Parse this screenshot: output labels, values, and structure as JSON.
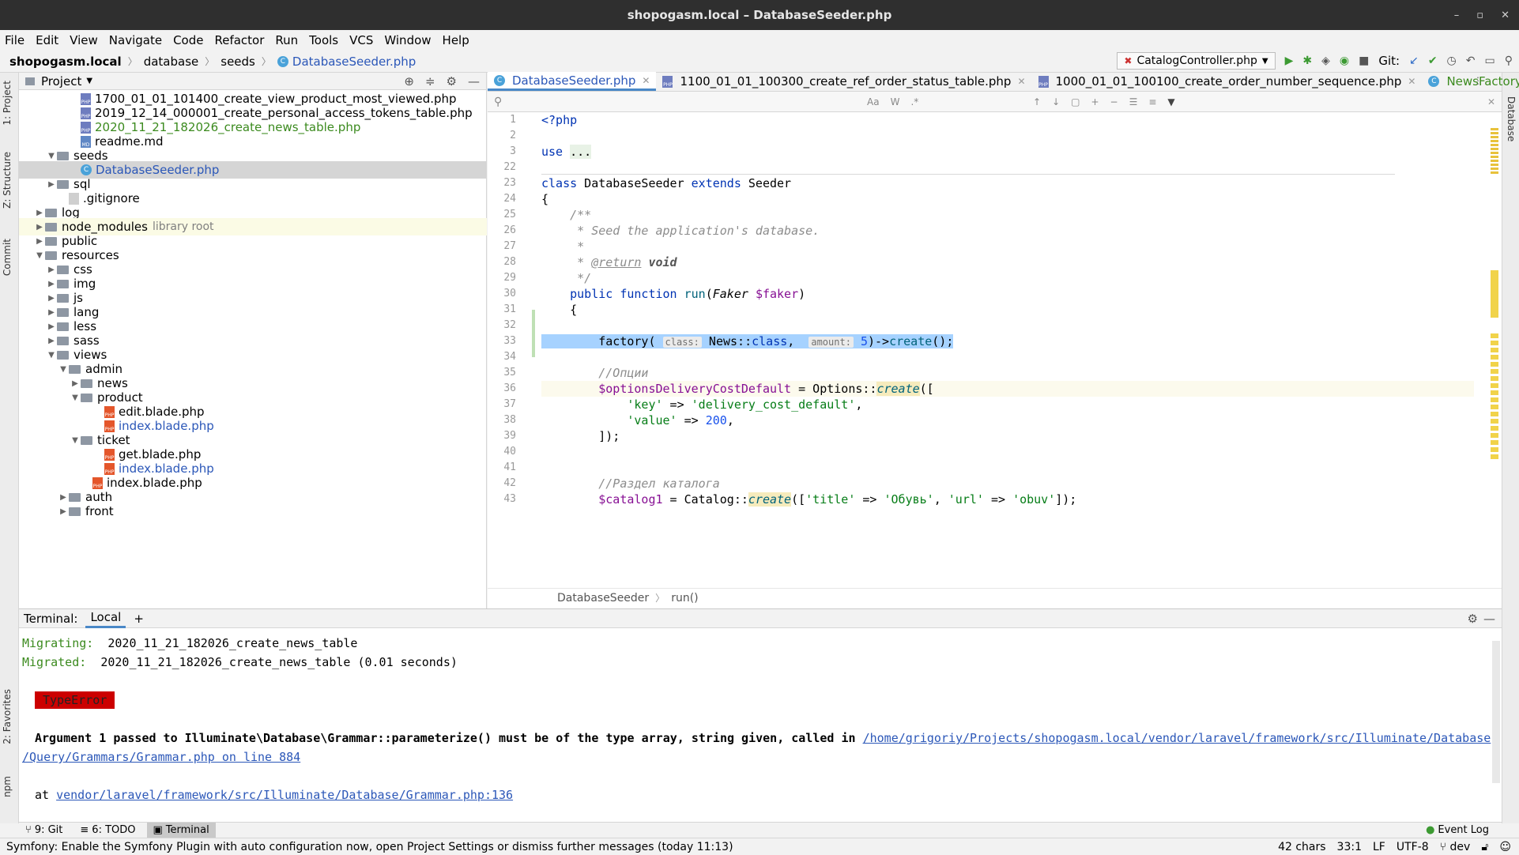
{
  "window": {
    "title": "shopogasm.local – DatabaseSeeder.php",
    "controls": [
      "–",
      "▫",
      "✕"
    ]
  },
  "menu": [
    "File",
    "Edit",
    "View",
    "Navigate",
    "Code",
    "Refactor",
    "Run",
    "Tools",
    "VCS",
    "Window",
    "Help"
  ],
  "nav": {
    "crumbs": [
      "shopogasm.local",
      "database",
      "seeds",
      "DatabaseSeeder.php"
    ],
    "run_config": "CatalogController.php",
    "git_label": "Git:"
  },
  "left_tabs": [
    "1: Project",
    "Z: Structure",
    "Commit",
    "2: Favorites",
    "npm"
  ],
  "right_tabs": [
    "Database"
  ],
  "project": {
    "title": "Project",
    "rows": [
      {
        "indent": 4,
        "kind": "php",
        "label": "1700_01_01_101400_create_view_product_most_viewed.php"
      },
      {
        "indent": 4,
        "kind": "php",
        "label": "2019_12_14_000001_create_personal_access_tokens_table.php"
      },
      {
        "indent": 4,
        "kind": "php",
        "label": "2020_11_21_182026_create_news_table.php",
        "style": "green"
      },
      {
        "indent": 4,
        "kind": "md",
        "label": "readme.md"
      },
      {
        "indent": 2,
        "kind": "folder",
        "arrow": "▼",
        "label": "seeds"
      },
      {
        "indent": 4,
        "kind": "class",
        "label": "DatabaseSeeder.php",
        "style": "blue",
        "selected": true
      },
      {
        "indent": 2,
        "kind": "folder",
        "arrow": "▶",
        "label": "sql"
      },
      {
        "indent": 3,
        "kind": "git",
        "label": ".gitignore"
      },
      {
        "indent": 1,
        "kind": "folder",
        "arrow": "▶",
        "label": "log"
      },
      {
        "indent": 1,
        "kind": "folder",
        "arrow": "▶",
        "label": "node_modules",
        "extra": "library root",
        "lib": true
      },
      {
        "indent": 1,
        "kind": "folder",
        "arrow": "▶",
        "label": "public"
      },
      {
        "indent": 1,
        "kind": "folder",
        "arrow": "▼",
        "label": "resources"
      },
      {
        "indent": 2,
        "kind": "folder",
        "arrow": "▶",
        "label": "css"
      },
      {
        "indent": 2,
        "kind": "folder",
        "arrow": "▶",
        "label": "img"
      },
      {
        "indent": 2,
        "kind": "folder",
        "arrow": "▶",
        "label": "js"
      },
      {
        "indent": 2,
        "kind": "folder",
        "arrow": "▶",
        "label": "lang"
      },
      {
        "indent": 2,
        "kind": "folder",
        "arrow": "▶",
        "label": "less"
      },
      {
        "indent": 2,
        "kind": "folder",
        "arrow": "▶",
        "label": "sass"
      },
      {
        "indent": 2,
        "kind": "folder",
        "arrow": "▼",
        "label": "views"
      },
      {
        "indent": 3,
        "kind": "folder",
        "arrow": "▼",
        "label": "admin"
      },
      {
        "indent": 4,
        "kind": "folder",
        "arrow": "▶",
        "label": "news"
      },
      {
        "indent": 4,
        "kind": "folder",
        "arrow": "▼",
        "label": "product"
      },
      {
        "indent": 6,
        "kind": "blade",
        "label": "edit.blade.php"
      },
      {
        "indent": 6,
        "kind": "blade",
        "label": "index.blade.php",
        "style": "blue"
      },
      {
        "indent": 4,
        "kind": "folder",
        "arrow": "▼",
        "label": "ticket"
      },
      {
        "indent": 6,
        "kind": "blade",
        "label": "get.blade.php"
      },
      {
        "indent": 6,
        "kind": "blade",
        "label": "index.blade.php",
        "style": "blue"
      },
      {
        "indent": 5,
        "kind": "blade",
        "label": "index.blade.php"
      },
      {
        "indent": 3,
        "kind": "folder",
        "arrow": "▶",
        "label": "auth"
      },
      {
        "indent": 3,
        "kind": "folder",
        "arrow": "▶",
        "label": "front"
      }
    ]
  },
  "tabs": [
    {
      "label": "DatabaseSeeder.php",
      "active": true,
      "icon": "class"
    },
    {
      "label": "1100_01_01_100300_create_ref_order_status_table.php",
      "icon": "php"
    },
    {
      "label": "1000_01_01_100100_create_order_number_sequence.php",
      "icon": "php"
    },
    {
      "label": "NewsFactory.php",
      "icon": "class",
      "style": "green"
    }
  ],
  "search": {
    "placeholder": "",
    "opts": [
      "Aa",
      "W",
      ".*"
    ]
  },
  "code": {
    "line_numbers": [
      "1",
      "2",
      "3",
      "22",
      "23",
      "24",
      "25",
      "26",
      "27",
      "28",
      "29",
      "30",
      "31",
      "32",
      "33",
      "34",
      "35",
      "36",
      "37",
      "38",
      "39",
      "40",
      "41",
      "42",
      "43"
    ]
  },
  "editor_breadcrumb": [
    "DatabaseSeeder",
    "run()"
  ],
  "terminal": {
    "label": "Terminal:",
    "tab": "Local",
    "add": "+",
    "lines": {
      "migrating_label": "Migrating:",
      "migrating_value": "2020_11_21_182026_create_news_table",
      "migrated_label": "Migrated:",
      "migrated_value": "2020_11_21_182026_create_news_table (0.01 seconds)",
      "error": "TypeError",
      "arg_text": "Argument 1 passed to Illuminate\\Database\\Grammar::parameterize() must be of the type array, string given, called in ",
      "arg_link1": "/home/grigoriy/Projects/shopogasm.local/vendor/laravel/framework/src/Illuminate/Database",
      "arg_link2": "/Query/Grammars/Grammar.php on line 884",
      "at_label": "at ",
      "at_link": "vendor/laravel/framework/src/Illuminate/Database/Grammar.php:136"
    }
  },
  "bottom_tools": [
    {
      "icon": "⑂",
      "label": "9: Git"
    },
    {
      "icon": "≡",
      "label": "6: TODO"
    },
    {
      "icon": "▣",
      "label": "Terminal",
      "active": true
    }
  ],
  "event_log": "Event Log",
  "status": {
    "message": "Symfony: Enable the Symfony Plugin with auto configuration now, open Project Settings or dismiss further messages (today 11:13)",
    "chars": "42 chars",
    "pos": "33:1",
    "eol": "LF",
    "enc": "UTF-8",
    "branch": "dev"
  },
  "colors": {
    "accent": "#4a88c7",
    "error_bg": "#cc0000",
    "green_text": "#3b8a1e"
  }
}
